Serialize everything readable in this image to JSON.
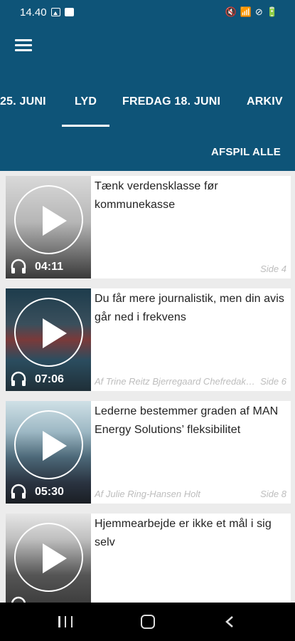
{
  "status_bar": {
    "time": "14.40",
    "right_glyphs": [
      "🔇",
      "📶",
      "⊘",
      "🔋"
    ]
  },
  "header": {
    "tabs": [
      {
        "label": "25. JUNI"
      },
      {
        "label": "LYD",
        "active": true
      },
      {
        "label": "FREDAG 18. JUNI"
      },
      {
        "label": "ARKIV"
      }
    ],
    "play_all_label": "AFSPIL ALLE"
  },
  "articles": [
    {
      "title": "Tænk verdensklasse før kommunekasse",
      "duration": "04:11",
      "author": "",
      "page": "Side 4"
    },
    {
      "title": "Du får mere journalistik, men din avis går ned i frekvens",
      "duration": "07:06",
      "author": "Af Trine Reitz Bjerregaard Chefredaktør",
      "page": "Side 6"
    },
    {
      "title": "Lederne bestemmer graden af MAN Energy Solutions’ fleksibilitet",
      "duration": "05:30",
      "author": "Af Julie Ring-Hansen Holt",
      "page": "Side 8"
    },
    {
      "title": "Hjemmearbejde er ikke et mål i sig selv",
      "duration": "",
      "author": "",
      "page": ""
    }
  ],
  "colors": {
    "header_bg": "#0e5478",
    "list_bg": "#ececec",
    "meta_text": "#bdbdbd"
  },
  "icons": [
    "menu-icon",
    "play-icon",
    "headphones-icon",
    "nav-recent-icon",
    "nav-home-icon",
    "nav-back-icon"
  ]
}
